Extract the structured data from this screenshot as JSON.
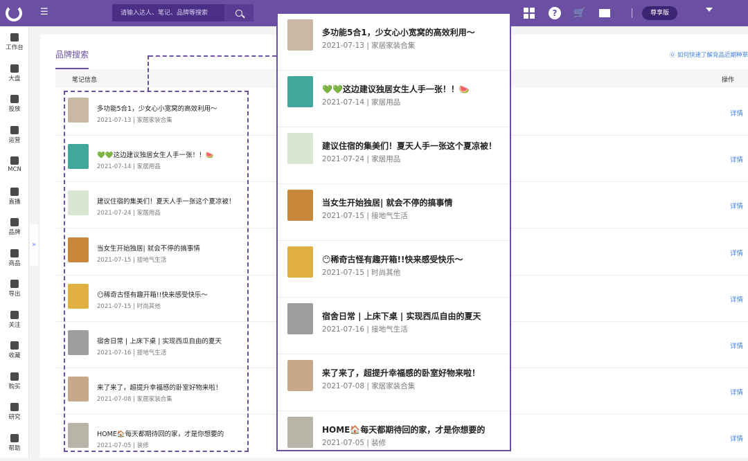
{
  "header": {
    "search_placeholder": "请输入达人、笔记、品牌等搜索",
    "vip_label": "尊享版",
    "icons": [
      "logo-icon",
      "menu-icon",
      "search-icon",
      "grid-icon",
      "help-icon",
      "cart-icon",
      "mail-icon",
      "chevron-down-icon"
    ],
    "help_glyph": "?"
  },
  "sidebar": {
    "items": [
      {
        "label": "工作台",
        "icon": "dashboard-icon"
      },
      {
        "label": "大盘",
        "icon": "pie-icon"
      },
      {
        "label": "投放",
        "icon": "folder-icon"
      },
      {
        "label": "运营",
        "icon": "chart-icon"
      },
      {
        "label": "MCN",
        "icon": "building-icon"
      },
      {
        "label": "直播",
        "icon": "video-icon"
      },
      {
        "label": "品牌",
        "icon": "brand-icon"
      },
      {
        "label": "商品",
        "icon": "bag-icon"
      },
      {
        "label": "导出",
        "icon": "export-icon"
      },
      {
        "label": "关注",
        "icon": "eye-icon"
      },
      {
        "label": "收藏",
        "icon": "heart-icon"
      },
      {
        "label": "购买",
        "icon": "cart-icon"
      },
      {
        "label": "研究",
        "icon": "flask-icon"
      },
      {
        "label": "帮助",
        "icon": "help-icon"
      }
    ],
    "expand_glyph": "»"
  },
  "main": {
    "tab_title": "品牌搜索",
    "hint": "⓪ 如何快速了解竞品近期种草",
    "col_note": "笔记信息",
    "col_op": "操作",
    "detail_label": "详情"
  },
  "notes": [
    {
      "title": "多功能5合1，少女心小宽窝的高效利用～",
      "date": "2021-07-13",
      "category": "家居家装合集",
      "color": "#c9b9a4"
    },
    {
      "title": "💚💚这边建议独居女生人手一张！！🍉",
      "date": "2021-07-14",
      "category": "家居用品",
      "color": "#3fa89b"
    },
    {
      "title": "建议住宿的集美们！夏天人手一张这个夏凉被！",
      "date": "2021-07-24",
      "category": "家居用品",
      "color": "#d8e6d2"
    },
    {
      "title": "当女生开始独居| 就会不停的搞事情",
      "date": "2021-07-15",
      "category": "接地气生活",
      "color": "#c8873a"
    },
    {
      "title": "😶稀奇古怪有趣开箱!!快来感受快乐～",
      "date": "2021-07-15",
      "category": "时尚其他",
      "color": "#e0b040"
    },
    {
      "title": "宿舍日常 | 上床下桌 | 实现西瓜自由的夏天",
      "date": "2021-07-16",
      "category": "接地气生活",
      "color": "#9e9e9e"
    },
    {
      "title": "来了来了，超提升幸福感的卧室好物来啦！",
      "date": "2021-07-08",
      "category": "家居家装合集",
      "color": "#c7a98a"
    },
    {
      "title": "HOME🏠每天都期待回的家，才是你想要的",
      "date": "2021-07-05",
      "category": "装修",
      "color": "#b8b4a8"
    }
  ]
}
